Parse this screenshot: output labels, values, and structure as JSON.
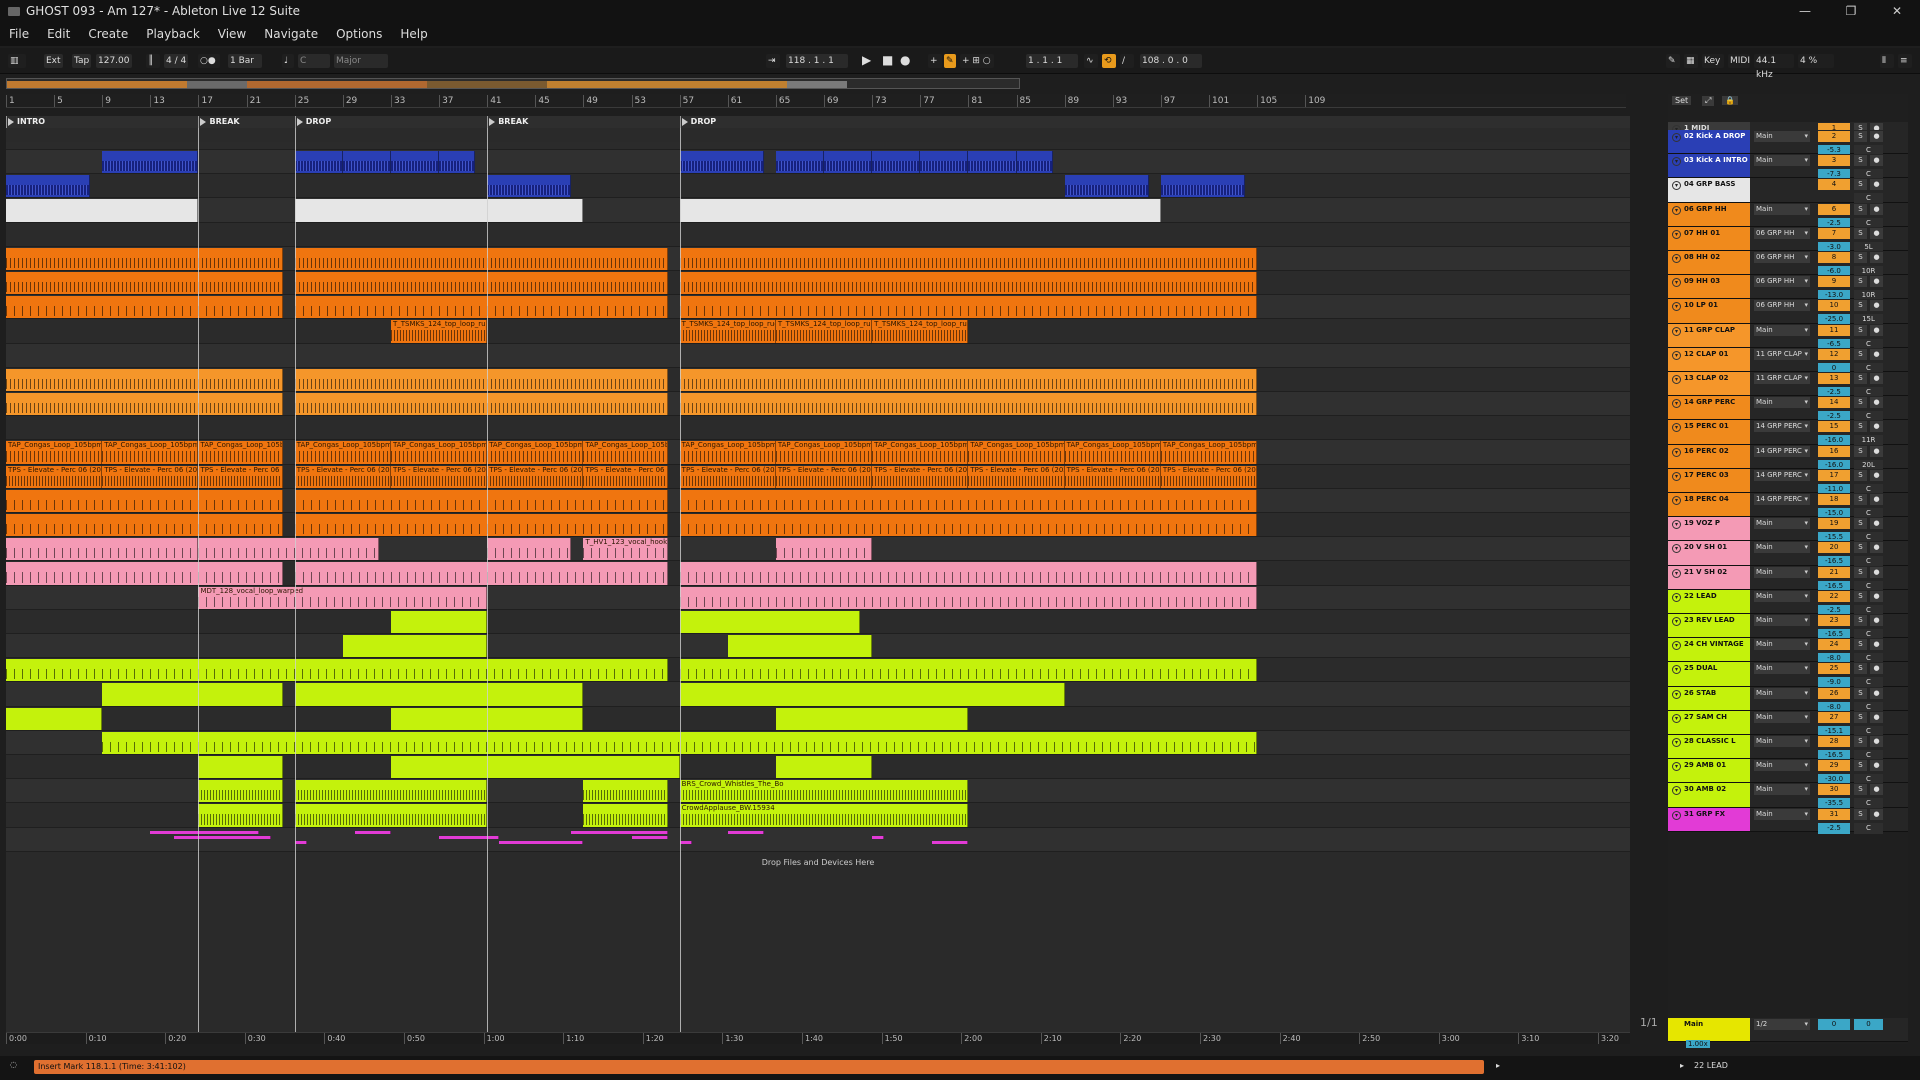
{
  "window": {
    "title": "GHOST 093 - Am 127* - Ableton Live 12 Suite",
    "controls": [
      "—",
      "❐",
      "✕"
    ]
  },
  "menu": [
    "File",
    "Edit",
    "Create",
    "Playback",
    "View",
    "Navigate",
    "Options",
    "Help"
  ],
  "controlbar": {
    "ext": "Ext",
    "tap": "Tap",
    "tempo": "127.00",
    "time_sig": "4 / 4",
    "quantize": "1 Bar",
    "key": "C",
    "scale": "Major",
    "position": "118 .  1 .  1",
    "loop_start": "1 .  1 .  1",
    "loop_length": "108 .  0 .  0",
    "key_label": "Key",
    "midi_label": "MIDI",
    "sample_rate": "44.1 kHz",
    "cpu": "4 %"
  },
  "ruler_bars": [
    "1",
    "5",
    "9",
    "13",
    "17",
    "21",
    "25",
    "29",
    "33",
    "37",
    "41",
    "45",
    "49",
    "53",
    "57",
    "61",
    "65",
    "69",
    "73",
    "77",
    "81",
    "85",
    "89",
    "93",
    "97",
    "101",
    "105",
    "109"
  ],
  "time_ruler": [
    "0:00",
    "0:10",
    "0:20",
    "0:30",
    "0:40",
    "0:50",
    "1:00",
    "1:10",
    "1:20",
    "1:30",
    "1:40",
    "1:50",
    "2:00",
    "2:10",
    "2:20",
    "2:30",
    "2:40",
    "2:50",
    "3:00",
    "3:10",
    "3:20"
  ],
  "locators": [
    {
      "name": "INTRO",
      "bar": 1
    },
    {
      "name": "BREAK",
      "bar": 17
    },
    {
      "name": "DROP",
      "bar": 25
    },
    {
      "name": "BREAK",
      "bar": 41
    },
    {
      "name": "DROP",
      "bar": 57
    }
  ],
  "colors": {
    "blue": "#2a3fb5",
    "white": "#e6e6e6",
    "orange": "#f0750f",
    "lightorange": "#f5962a",
    "pink": "#f49ab5",
    "lime": "#c4f20c",
    "magenta": "#e23bd6",
    "group_orange": "#f08a1c"
  },
  "clip_names": {
    "top_loop": "T_TSMKS_124_top_loop_rugg",
    "congas": "TAP_Congas_Loop_105bpm_0",
    "perc06": "TPS - Elevate - Perc 06 (2023-0",
    "vocal_hook": "T_HV1_123_vocal_hook",
    "vocal_loop": "MDT_128_vocal_loop_warped",
    "crowd_whistles": "BRS_Crowd_Whistles_The_Bo",
    "crowd_applause": "CrowdApplause_BW.15934"
  },
  "drop_zone": "Drop Files and Devices Here",
  "zoom_indicator": "1/1",
  "mixer_header": {
    "set": "Set"
  },
  "tracks": [
    {
      "name": "1 MIDI",
      "route": "",
      "num": "1",
      "vol": "",
      "color": "#3a3a3a",
      "text": "#ddd"
    },
    {
      "name": "02 Kick A DROP",
      "route": "Main",
      "num": "2",
      "vol": "-5.3",
      "color": "#2a3fb5",
      "text": "#fff"
    },
    {
      "name": "03 Kick A INTRO",
      "route": "Main",
      "num": "3",
      "vol": "-7.3",
      "color": "#2a3fb5",
      "text": "#fff"
    },
    {
      "name": "04 GRP BASS",
      "route": "",
      "num": "4",
      "vol": "",
      "color": "#e6e6e6",
      "text": "#111"
    },
    {
      "name": "06 GRP HH",
      "route": "Main",
      "num": "6",
      "vol": "-2.5",
      "color": "#f08a1c",
      "text": "#111"
    },
    {
      "name": "07 HH 01",
      "route": "06 GRP HH",
      "num": "7",
      "vol": "-3.0",
      "color": "#f08a1c",
      "text": "#111",
      "pan": "5L"
    },
    {
      "name": "08 HH 02",
      "route": "06 GRP HH",
      "num": "8",
      "vol": "-6.0",
      "color": "#f08a1c",
      "text": "#111",
      "pan": "10R"
    },
    {
      "name": "09 HH 03",
      "route": "06 GRP HH",
      "num": "9",
      "vol": "-13.0",
      "color": "#f08a1c",
      "text": "#111",
      "pan": "10R"
    },
    {
      "name": "10 LP 01",
      "route": "06 GRP HH",
      "num": "10",
      "vol": "-25.0",
      "color": "#f08a1c",
      "text": "#111",
      "pan": "15L"
    },
    {
      "name": "11 GRP CLAP",
      "route": "Main",
      "num": "11",
      "vol": "-6.5",
      "color": "#f5962a",
      "text": "#111"
    },
    {
      "name": "12 CLAP 01",
      "route": "11 GRP CLAP",
      "num": "12",
      "vol": "0",
      "color": "#f5962a",
      "text": "#111"
    },
    {
      "name": "13 CLAP 02",
      "route": "11 GRP CLAP",
      "num": "13",
      "vol": "-2.5",
      "color": "#f5962a",
      "text": "#111"
    },
    {
      "name": "14 GRP PERC",
      "route": "Main",
      "num": "14",
      "vol": "-2.5",
      "color": "#f08a1c",
      "text": "#111"
    },
    {
      "name": "15 PERC 01",
      "route": "14 GRP PERC",
      "num": "15",
      "vol": "-16.0",
      "color": "#f08a1c",
      "text": "#111",
      "pan": "11R"
    },
    {
      "name": "16 PERC 02",
      "route": "14 GRP PERC",
      "num": "16",
      "vol": "-16.0",
      "color": "#f08a1c",
      "text": "#111",
      "pan": "20L"
    },
    {
      "name": "17 PERC 03",
      "route": "14 GRP PERC",
      "num": "17",
      "vol": "-11.0",
      "color": "#f08a1c",
      "text": "#111"
    },
    {
      "name": "18 PERC 04",
      "route": "14 GRP PERC",
      "num": "18",
      "vol": "-15.0",
      "color": "#f08a1c",
      "text": "#111"
    },
    {
      "name": "19 VOZ P",
      "route": "Main",
      "num": "19",
      "vol": "-15.5",
      "color": "#f49ab5",
      "text": "#111"
    },
    {
      "name": "20 V SH 01",
      "route": "Main",
      "num": "20",
      "vol": "-16.5",
      "color": "#f49ab5",
      "text": "#111"
    },
    {
      "name": "21 V SH 02",
      "route": "Main",
      "num": "21",
      "vol": "-16.5",
      "color": "#f49ab5",
      "text": "#111"
    },
    {
      "name": "22 LEAD",
      "route": "Main",
      "num": "22",
      "vol": "-2.5",
      "color": "#c4f20c",
      "text": "#111"
    },
    {
      "name": "23 REV LEAD",
      "route": "Main",
      "num": "23",
      "vol": "-16.5",
      "color": "#c4f20c",
      "text": "#111"
    },
    {
      "name": "24 CH VINTAGE",
      "route": "Main",
      "num": "24",
      "vol": "-8.0",
      "color": "#c4f20c",
      "text": "#111"
    },
    {
      "name": "25 DUAL",
      "route": "Main",
      "num": "25",
      "vol": "-9.0",
      "color": "#c4f20c",
      "text": "#111"
    },
    {
      "name": "26 STAB",
      "route": "Main",
      "num": "26",
      "vol": "-8.0",
      "color": "#c4f20c",
      "text": "#111"
    },
    {
      "name": "27 SAM CH",
      "route": "Main",
      "num": "27",
      "vol": "-15.1",
      "color": "#c4f20c",
      "text": "#111"
    },
    {
      "name": "28 CLASSIC L",
      "route": "Main",
      "num": "28",
      "vol": "-16.5",
      "color": "#c4f20c",
      "text": "#111"
    },
    {
      "name": "29 AMB 01",
      "route": "Main",
      "num": "29",
      "vol": "-30.0",
      "color": "#c4f20c",
      "text": "#111"
    },
    {
      "name": "30 AMB 02",
      "route": "Main",
      "num": "30",
      "vol": "-35.5",
      "color": "#c4f20c",
      "text": "#111"
    },
    {
      "name": "31 GRP FX",
      "route": "Main",
      "num": "31",
      "vol": "-2.5",
      "color": "#e23bd6",
      "text": "#111"
    }
  ],
  "master": {
    "name": "Main",
    "route": "1/2",
    "num": "0",
    "vol": "0",
    "zoom": "1.00x"
  },
  "status": {
    "message": "Insert Mark 118.1.1 (Time: 3:41:102)",
    "selected_track": "22 LEAD"
  }
}
